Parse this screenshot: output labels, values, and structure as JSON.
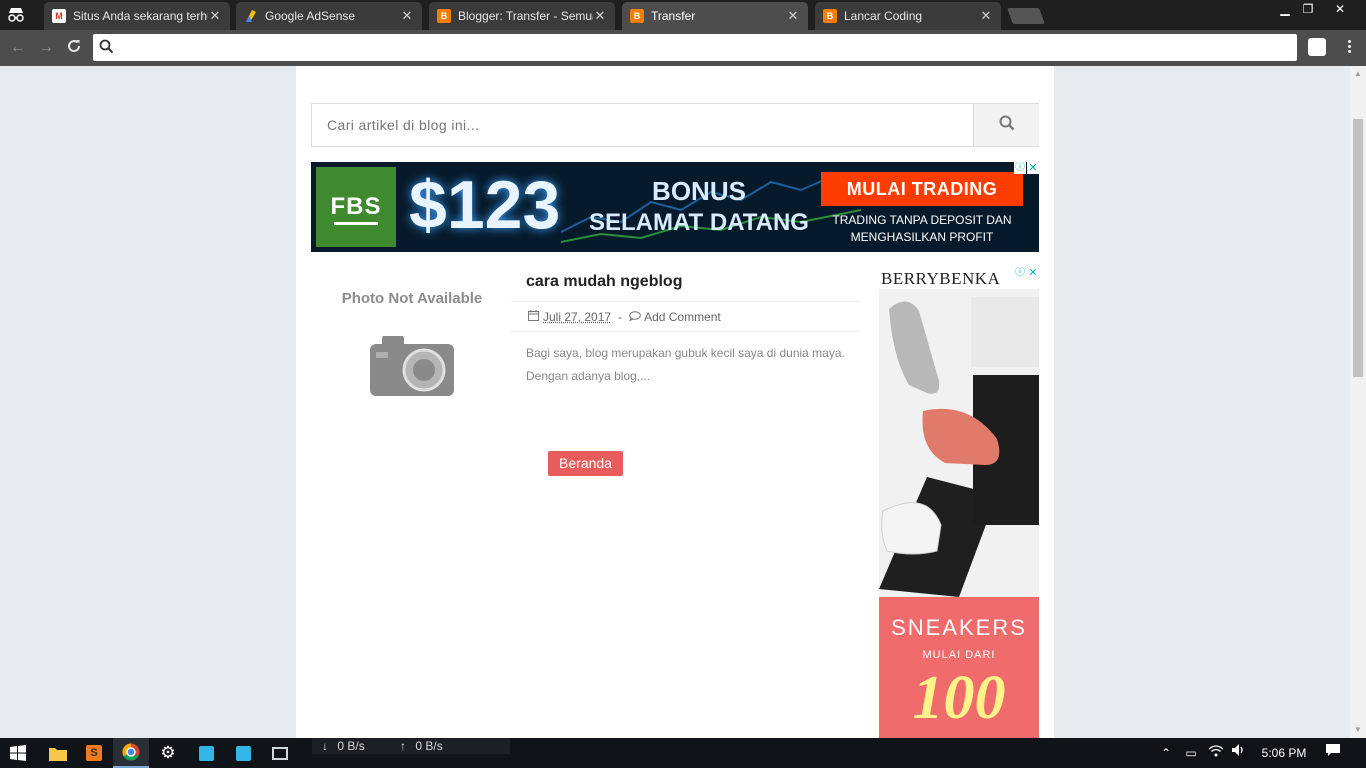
{
  "browser": {
    "tabs": [
      {
        "title": "Situs Anda sekarang terhubung",
        "favicon": "gmail-icon",
        "color": "#d93025"
      },
      {
        "title": "Google AdSense",
        "favicon": "adsense-icon",
        "color": "#fbbc05"
      },
      {
        "title": "Blogger: Transfer - Semua",
        "favicon": "blogger-icon",
        "color": "#f57d00"
      },
      {
        "title": "Transfer",
        "favicon": "blogger-icon",
        "color": "#f57d00",
        "active": true
      },
      {
        "title": "Lancar Coding",
        "favicon": "blogger-icon",
        "color": "#f57d00"
      }
    ],
    "address": ""
  },
  "page": {
    "search_placeholder": "Cari artikel di blog ini...",
    "banner_ad": {
      "logo": "FBS",
      "amount": "$123",
      "line1": "BONUS",
      "line2": "SELAMAT DATANG",
      "cta": "MULAI TRADING",
      "sub1": "TRADING TANPA DEPOSIT DAN",
      "sub2": "MENGHASILKAN PROFIT"
    },
    "post": {
      "thumbnail_text": "Photo Not Available",
      "title": "cara mudah ngeblog",
      "date": "Juli 27, 2017",
      "separator": "-",
      "comments": "Add Comment",
      "excerpt": "Bagi saya, blog merupakan gubuk kecil saya di dunia maya. Dengan adanya blog,..."
    },
    "home_button": "Beranda",
    "side_ad": {
      "brand": "BERRYBENKA",
      "headline": "SNEAKERS",
      "subline": "MULAI DARI",
      "price": "100"
    }
  },
  "taskbar": {
    "download_speed": "0 B/s",
    "upload_speed": "0 B/s",
    "time": "5:06 PM"
  }
}
